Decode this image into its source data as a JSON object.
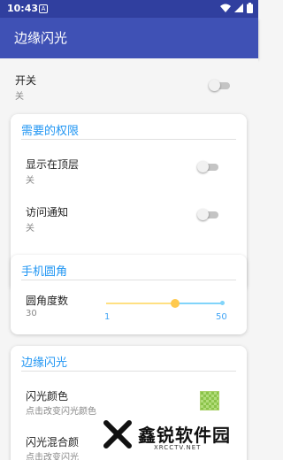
{
  "status_bar": {
    "time": "10:43",
    "notification_icon": "A"
  },
  "app_bar": {
    "title": "边缘闪光"
  },
  "toggle_row": {
    "title": "开关",
    "subtitle": "关",
    "on": false
  },
  "permissions_card": {
    "title": "需要的权限",
    "items": [
      {
        "title": "显示在顶层",
        "subtitle": "关",
        "on": false
      },
      {
        "title": "访问通知",
        "subtitle": "关",
        "on": false
      }
    ]
  },
  "corner_card": {
    "title": "手机圆角",
    "item": {
      "title": "圆角度数",
      "value": "30",
      "min_label": "1",
      "max_label": "50",
      "min": 1,
      "max": 50,
      "current": 30
    }
  },
  "flash_card": {
    "title": "边缘闪光",
    "color_item": {
      "title": "闪光颜色",
      "subtitle": "点击改变闪光颜色",
      "swatch_color": "#8bc34a"
    },
    "blend_item": {
      "title": "闪光混合颜",
      "subtitle": "点击改变闪光"
    }
  },
  "watermark": {
    "text": "鑫锐软件园",
    "url": "XRCCTV.NET"
  },
  "colors": {
    "primary": "#3f51b5",
    "primary_dark": "#303f9f",
    "accent": "#2196f3"
  }
}
